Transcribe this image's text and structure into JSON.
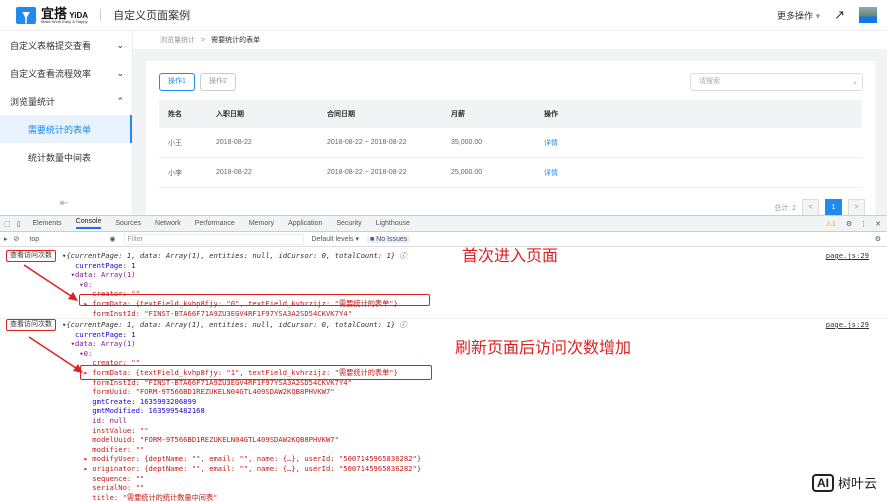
{
  "header": {
    "brand": "宜搭",
    "brand_en": "YiDA",
    "slogan": "Make Work Easy & Happy",
    "app_title": "自定义页面案例",
    "more_actions": "更多操作"
  },
  "sidebar": {
    "items": [
      {
        "label": "自定义表格提交查看",
        "chevron": "⌄"
      },
      {
        "label": "自定义查看流程效率",
        "chevron": "⌄"
      },
      {
        "label": "浏览量统计",
        "chevron": "⌃"
      },
      {
        "label": "需要统计的表单"
      },
      {
        "label": "统计数量中间表"
      }
    ],
    "collapse_icon": "⇤"
  },
  "breadcrumb": [
    "浏览量统计",
    ">",
    "需要统计的表单"
  ],
  "toolbar": {
    "btn1": "操作1",
    "btn2": "操作2",
    "search_placeholder": "请搜索"
  },
  "table": {
    "headers": [
      "姓名",
      "入职日期",
      "合同日期",
      "月薪",
      "操作"
    ],
    "rows": [
      [
        "小王",
        "2018-08-22",
        "2018-08-22 ~ 2018-08-22",
        "35,000.00",
        "详情"
      ],
      [
        "小李",
        "2018-08-22",
        "2018-08-22 ~ 2018-08-22",
        "25,000.00",
        "详情"
      ]
    ]
  },
  "pager": {
    "total": "总计: 2",
    "prev": "<",
    "page": "1",
    "next": ">"
  },
  "devtools": {
    "tabs": [
      "Elements",
      "Console",
      "Sources",
      "Network",
      "Performance",
      "Memory",
      "Application",
      "Security",
      "Lighthouse"
    ],
    "warn": "⚠1",
    "context": "top",
    "filter_placeholder": "Filter",
    "levels": "Default levels ▾",
    "issues": "No Issues"
  },
  "console": {
    "group1": {
      "label": "查看访问次数",
      "ref": "page.js:29",
      "annotation": "首次进入页面",
      "lines": [
        "▾{currentPage: 1, data: Array(1), entities: null, idCursor: 0, totalCount: 1} ⓘ",
        "   currentPage: 1",
        "  ▾data: Array(1)",
        "    ▾0:",
        "       creator: \"\"",
        "     ▸ formData: {textField_kvhp8fjy: \"0\", textField_kvhrzijz: \"需要统计的表单\"}",
        "       formInstId: \"FINST-BTA66F71A9ZU3EGV4RF1F97YSA3A2SD54CKVK7Y4\""
      ]
    },
    "group2": {
      "label": "查看访问次数",
      "ref": "page.js:29",
      "annotation": "刷新页面后访问次数增加",
      "lines": [
        "▾{currentPage: 1, data: Array(1), entities: null, idCursor: 0, totalCount: 1} ⓘ",
        "   currentPage: 1",
        "  ▾data: Array(1)",
        "    ▾0:",
        "       creator: \"\"",
        "     ▸ formData: {textField_kvhp8fjy: \"1\", textField_kvhrzijz: \"需要统计的表单\"}",
        "       formInstId: \"FINST-BTA66F71A9ZU3EGV4RF1F97YSA3A2SD54CKVK7Y4\"",
        "       formUuid: \"FORM-9T566BD1REZUKELN04GTL409SDAW2KQB8PHVKW7\"",
        "       gmtCreate: 1635993206899",
        "       gmtModified: 1635995482168",
        "       id: null",
        "       instValue: \"\"",
        "       modelUuid: \"FORM-9T566BD1REZUKELN04GTL409SDAW2KQB8PHVKW7\"",
        "       modifier: \"\"",
        "     ▸ modifyUser: {deptName: \"\", email: \"\", name: {…}, userId: \"5007145965836282\"}",
        "     ▸ originator: {deptName: \"\", email: \"\", name: {…}, userId: \"5007145965836282\"}",
        "       sequence: \"\"",
        "       serialNo: \"\"",
        "       title: \"需要统计的统计数量中间表\""
      ]
    }
  },
  "watermark": {
    "badge": "AI",
    "text": "树叶云"
  }
}
